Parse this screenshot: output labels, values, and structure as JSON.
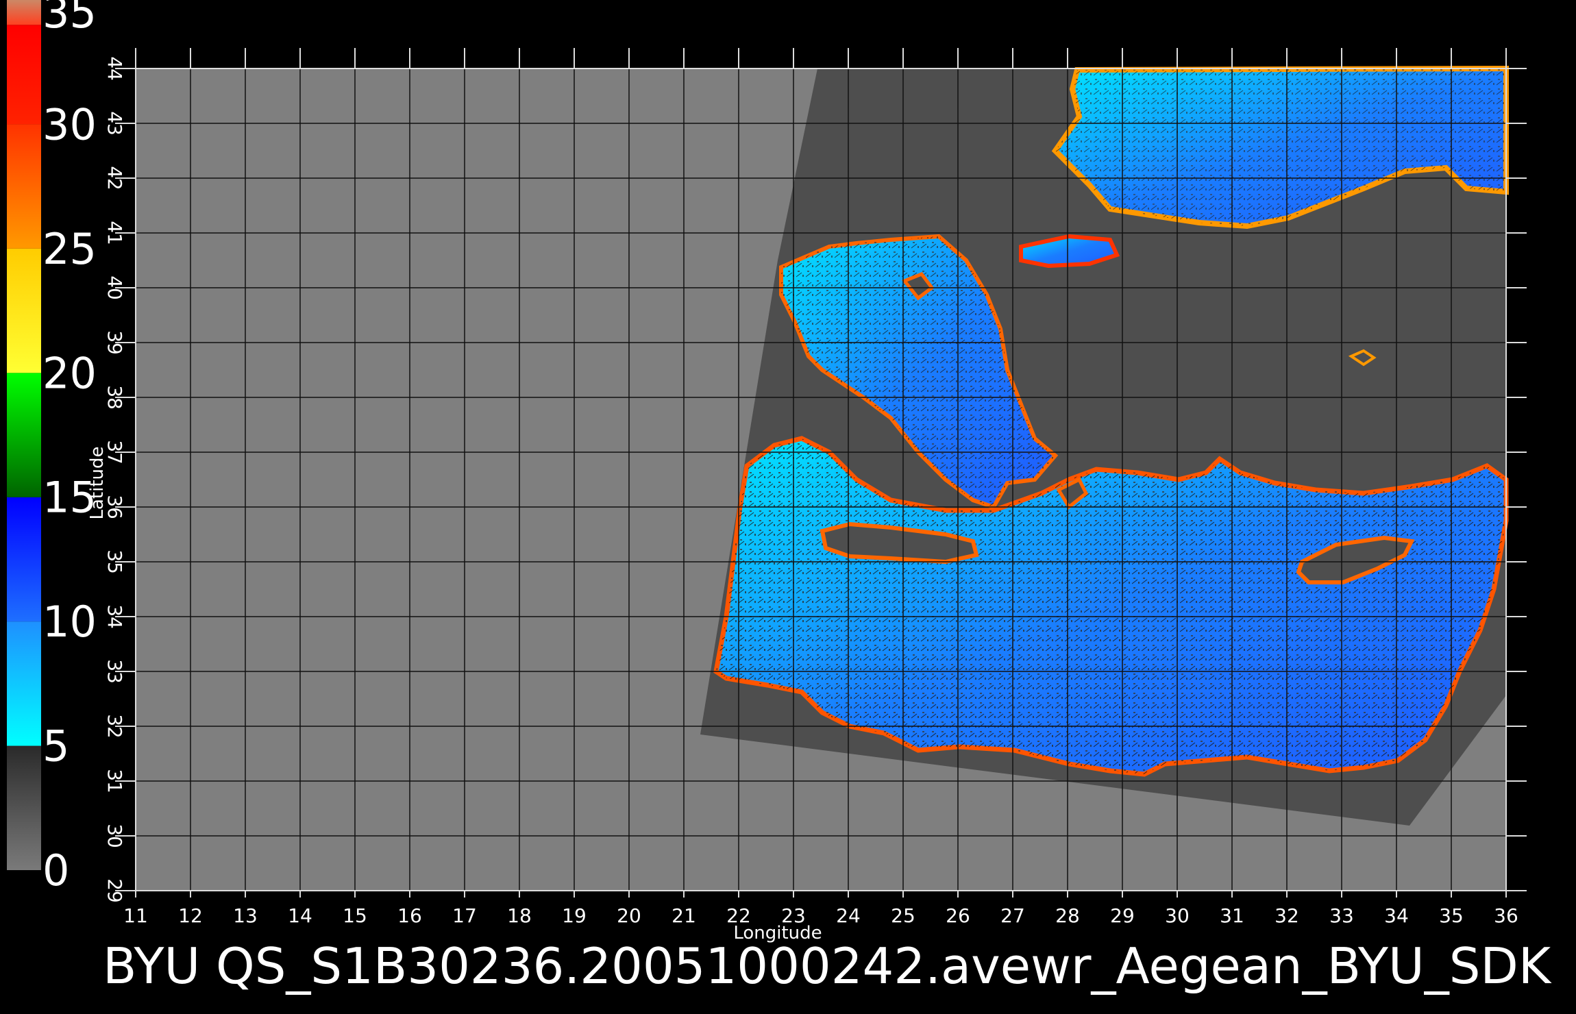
{
  "title": "BYU  QS_S1B30236.20051000242.avewr_Aegean_BYU_SDK",
  "axes": {
    "xlabel": "Longitude",
    "ylabel": "Latitude",
    "lon_ticks": [
      11,
      12,
      13,
      14,
      15,
      16,
      17,
      18,
      19,
      20,
      21,
      22,
      23,
      24,
      25,
      26,
      27,
      28,
      29,
      30,
      31,
      32,
      33,
      34,
      35,
      36
    ],
    "lat_ticks": [
      29,
      30,
      31,
      32,
      33,
      34,
      35,
      36,
      37,
      38,
      39,
      40,
      41,
      42,
      43,
      44
    ],
    "lon_range": [
      11,
      36
    ],
    "lat_range": [
      29,
      44
    ]
  },
  "colorbar": {
    "labels": [
      "35",
      "30",
      "25",
      "20",
      "15",
      "10",
      "5",
      "0"
    ],
    "segments": [
      {
        "from": 0,
        "to": 5,
        "colors": [
          "#7a7a7a",
          "#2a2a2a"
        ]
      },
      {
        "from": 5,
        "to": 10,
        "colors": [
          "#00ffff",
          "#1e90ff"
        ]
      },
      {
        "from": 10,
        "to": 15,
        "colors": [
          "#1e6fff",
          "#0000ff"
        ]
      },
      {
        "from": 15,
        "to": 20,
        "colors": [
          "#006400",
          "#00ff00"
        ]
      },
      {
        "from": 20,
        "to": 25,
        "colors": [
          "#ffff33",
          "#ffcc00"
        ]
      },
      {
        "from": 25,
        "to": 30,
        "colors": [
          "#ff9900",
          "#ff3300"
        ]
      },
      {
        "from": 30,
        "to": 34,
        "colors": [
          "#ff2200",
          "#ff0000"
        ]
      },
      {
        "from": 34,
        "to": 35,
        "colors": [
          "#ff4020",
          "#cc8866"
        ]
      }
    ]
  },
  "colors": {
    "map_background": "#7f7f7f",
    "swath": "#4e4e4e",
    "grid": "#111111",
    "land_in_swath": "#4e4e4e"
  }
}
